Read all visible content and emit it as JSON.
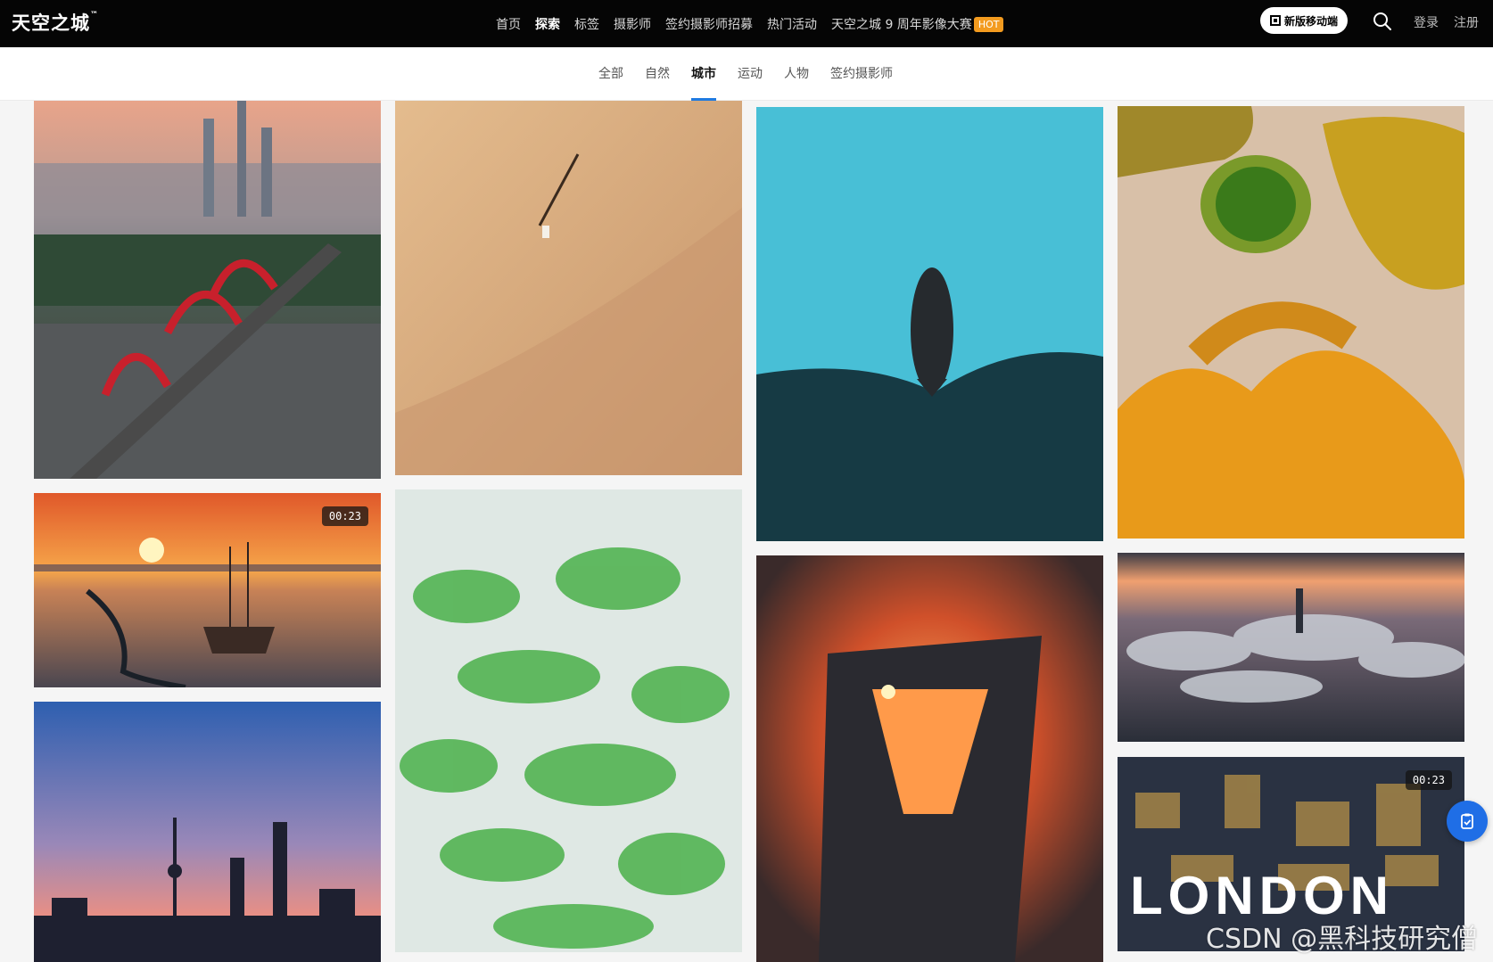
{
  "header": {
    "logo": "天空之城",
    "logo_tm": "™",
    "nav": [
      "首页",
      "探索",
      "标签",
      "摄影师",
      "签约摄影师招募",
      "热门活动",
      "天空之城 9 周年影像大赛"
    ],
    "active_nav": "探索",
    "hot_badge": "HOT",
    "mobile_button": "新版移动端",
    "search_icon": "search-icon",
    "login": "登录",
    "register": "注册"
  },
  "categories": {
    "items": [
      "全部",
      "自然",
      "城市",
      "运动",
      "人物",
      "签约摄影师"
    ],
    "active": "城市",
    "accent_color": "#1f7ae0"
  },
  "gallery": {
    "tiles": [
      {
        "id": "bridge-city",
        "badge": null
      },
      {
        "id": "desert-beach",
        "badge": null
      },
      {
        "id": "whale-ocean",
        "badge": null
      },
      {
        "id": "salt-lakes",
        "badge": null
      },
      {
        "id": "sunset-ship",
        "badge": "00:23"
      },
      {
        "id": "green-wetland",
        "badge": null
      },
      {
        "id": "sunset-tower",
        "badge": null
      },
      {
        "id": "cloud-city",
        "badge": null
      },
      {
        "id": "shanghai-skyline",
        "badge": null
      },
      {
        "id": "london-night",
        "badge": "00:23",
        "overlay": "LONDON"
      }
    ]
  },
  "floating_button_icon": "feedback-icon",
  "watermark": "CSDN @黑科技研究僧"
}
